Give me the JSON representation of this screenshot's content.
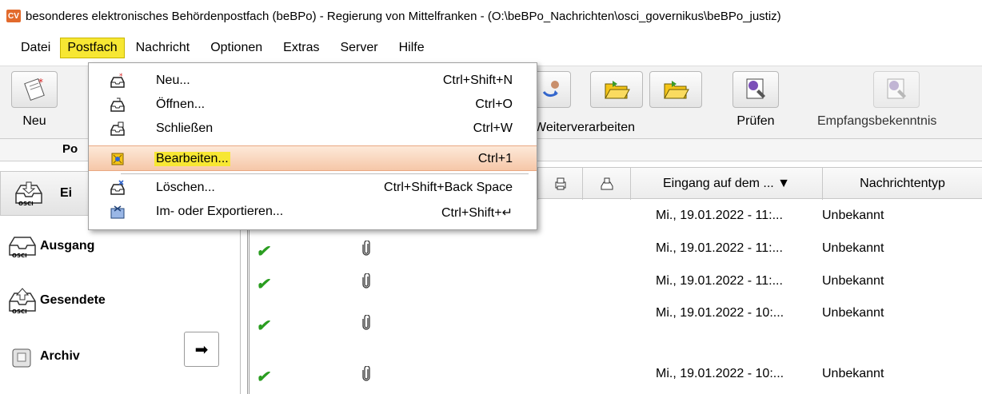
{
  "window": {
    "logo_text": "CV",
    "title": "besonderes elektronisches Behördenpostfach (beBPo) - Regierung von Mittelfranken - (O:\\beBPo_Nachrichten\\osci_governikus\\beBPo_justiz)"
  },
  "menubar": {
    "items": [
      "Datei",
      "Postfach",
      "Nachricht",
      "Optionen",
      "Extras",
      "Server",
      "Hilfe"
    ],
    "active": "Postfach"
  },
  "toolbar": {
    "new_label": "Neu",
    "weiterverarbeiten_label": "Weiterverarbeiten",
    "pruefen_label": "Prüfen",
    "empfangsbekenntnis_label": "Empfangsbekenntnis"
  },
  "tabs": {
    "postfach_tab": "Po"
  },
  "sidebar": {
    "items": [
      {
        "label": "Eingang",
        "visible_label": "Ei"
      },
      {
        "label": "Ausgang"
      },
      {
        "label": "Gesendete"
      },
      {
        "label": "Archiv"
      }
    ],
    "arrow_symbol": "➡"
  },
  "table": {
    "headers": {
      "eingang": "Eingang auf dem ... ▼",
      "typ": "Nachrichtentyp"
    },
    "rows": [
      {
        "date": "Mi., 19.01.2022 - 11:...",
        "type": "Unbekannt",
        "checked": false,
        "attachment": false
      },
      {
        "date": "Mi., 19.01.2022 - 11:...",
        "type": "Unbekannt",
        "checked": true,
        "attachment": true
      },
      {
        "date": "Mi., 19.01.2022 - 11:...",
        "type": "Unbekannt",
        "checked": true,
        "attachment": true
      },
      {
        "date": "Mi., 19.01.2022 - 10:...",
        "type": "Unbekannt",
        "checked": true,
        "attachment": true
      },
      {
        "date": "Mi., 19.01.2022 - 10:...",
        "type": "Unbekannt",
        "checked": true,
        "attachment": true
      }
    ]
  },
  "dropdown": {
    "items": [
      {
        "label": "Neu...",
        "shortcut": "Ctrl+Shift+N",
        "icon": "new-mailbox-icon"
      },
      {
        "label": "Öffnen...",
        "shortcut": "Ctrl+O",
        "icon": "open-mailbox-icon"
      },
      {
        "label": "Schließen",
        "shortcut": "Ctrl+W",
        "icon": "close-mailbox-icon"
      },
      {
        "label": "Bearbeiten...",
        "shortcut": "Ctrl+1",
        "icon": "edit-mailbox-icon",
        "highlighted": true
      },
      {
        "label": "Löschen...",
        "shortcut": "Ctrl+Shift+Back Space",
        "icon": "delete-mailbox-icon"
      },
      {
        "label": "Im- oder Exportieren...",
        "shortcut": "Ctrl+Shift+↵",
        "icon": "import-export-icon"
      }
    ]
  },
  "colors": {
    "menu_highlight": "#f7e733",
    "dropdown_highlight": "#f6c7a8",
    "check": "#2a9d20"
  }
}
